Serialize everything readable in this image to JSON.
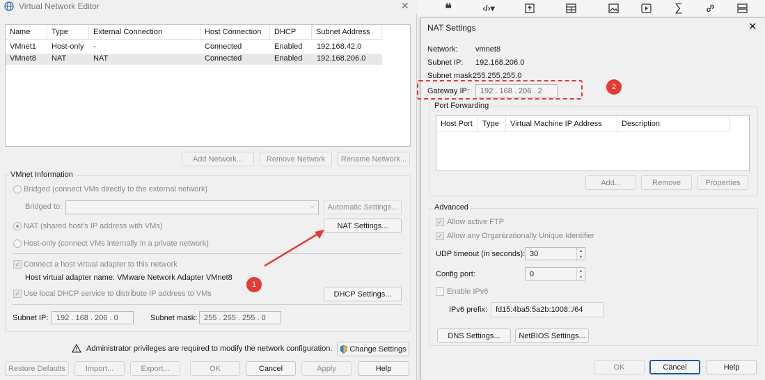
{
  "vne": {
    "title": "Virtual Network Editor",
    "columns": [
      "Name",
      "Type",
      "External Connection",
      "Host Connection",
      "DHCP",
      "Subnet Address"
    ],
    "rows": [
      {
        "name": "VMnet1",
        "type": "Host-only",
        "external": "-",
        "host": "Connected",
        "dhcp": "Enabled",
        "subnet": "192.168.42.0"
      },
      {
        "name": "VMnet8",
        "type": "NAT",
        "external": "NAT",
        "host": "Connected",
        "dhcp": "Enabled",
        "subnet": "192.168.206.0"
      }
    ],
    "add_network": "Add Network...",
    "remove_network": "Remove Network",
    "rename_network": "Rename Network...",
    "vmnet_info": "VMnet Information",
    "bridged": "Bridged (connect VMs directly to the external network)",
    "bridged_to": "Bridged to:",
    "auto_settings": "Automatic Settings...",
    "nat": "NAT (shared host's IP address with VMs)",
    "nat_settings": "NAT Settings...",
    "hostonly": "Host-only (connect VMs internally in a private network)",
    "connect_adapter": "Connect a host virtual adapter to this network",
    "adapter_name": "Host virtual adapter name: VMware Network Adapter VMnet8",
    "use_dhcp": "Use local DHCP service to distribute IP address to VMs",
    "dhcp_settings": "DHCP Settings...",
    "subnet_ip_label": "Subnet IP:",
    "subnet_ip": "192 . 168 . 206 .  0",
    "subnet_mask_label": "Subnet mask:",
    "subnet_mask": "255 . 255 . 255 .  0",
    "admin_msg": "Administrator privileges are required to modify the network configuration.",
    "change_settings": "Change Settings",
    "restore_defaults": "Restore Defaults",
    "import": "Import...",
    "export": "Export...",
    "ok": "OK",
    "cancel": "Cancel",
    "apply": "Apply",
    "help": "Help"
  },
  "nat": {
    "title": "NAT Settings",
    "network_label": "Network:",
    "network": "vmnet8",
    "subnet_ip_label": "Subnet IP:",
    "subnet_ip": "192.168.206.0",
    "subnet_mask_label": "Subnet mask:",
    "subnet_mask": "255.255.255.0",
    "gateway_label": "Gateway IP:",
    "gateway": "192 . 168 . 206 .  2",
    "port_forwarding": "Port Forwarding",
    "pf_columns": [
      "Host Port",
      "Type",
      "Virtual Machine IP Address",
      "Description"
    ],
    "add": "Add...",
    "remove": "Remove",
    "properties": "Properties",
    "advanced": "Advanced",
    "allow_ftp": "Allow active FTP",
    "allow_oui": "Allow any Organizationally Unique Identifier",
    "udp_label": "UDP timeout (in seconds):",
    "udp": "30",
    "config_port_label": "Config port:",
    "config_port": "0",
    "enable_ipv6": "Enable IPv6",
    "ipv6_label": "IPv6 prefix:",
    "ipv6": "fd15:4ba5:5a2b:1008::/64",
    "dns_settings": "DNS Settings...",
    "netbios_settings": "NetBIOS Settings...",
    "ok": "OK",
    "cancel": "Cancel",
    "help": "Help"
  },
  "annotations": {
    "marker1": "1",
    "marker2": "2",
    "color": "#e53935"
  },
  "toolbar_icons": [
    "quote-icon",
    "code-icon",
    "upload-icon",
    "table-icon",
    "image-icon",
    "video-icon",
    "sigma-icon",
    "link-icon",
    "more-icon"
  ]
}
